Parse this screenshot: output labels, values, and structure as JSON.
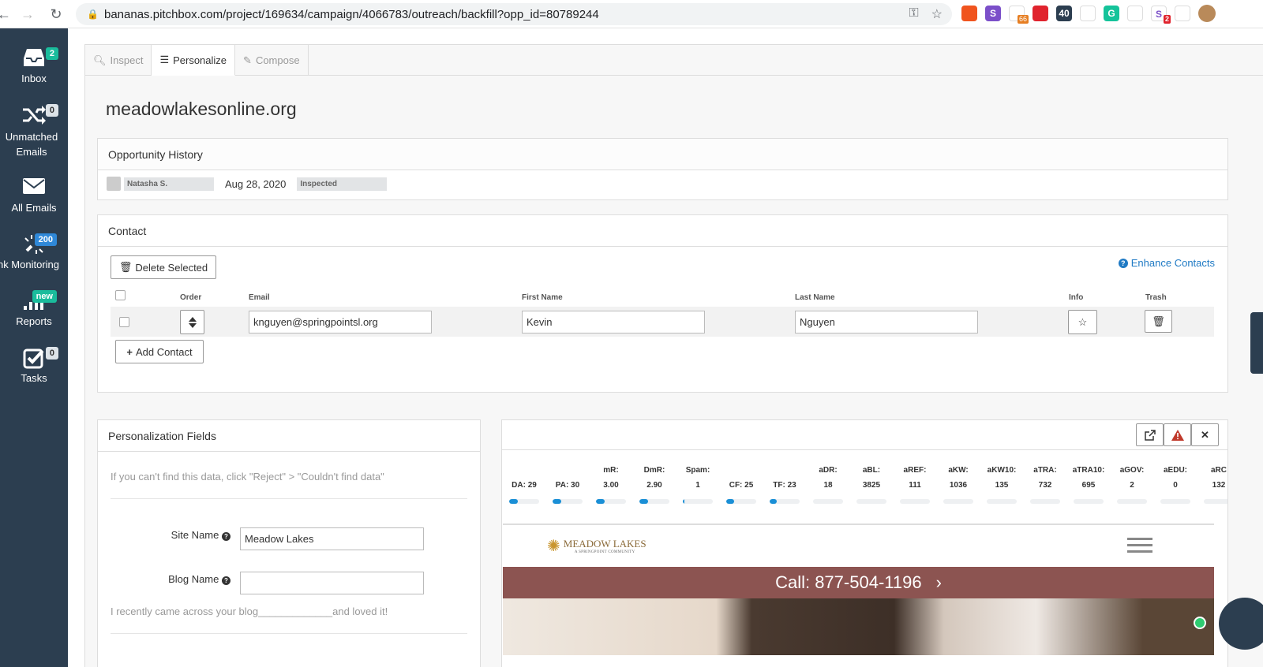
{
  "browser": {
    "url": "bananas.pitchbox.com/project/169634/campaign/4066783/outreach/backfill?opp_id=80789244",
    "extensions": [
      {
        "name": "ext-fox-icon",
        "color": "#f0541e"
      },
      {
        "name": "ext-s-icon",
        "color": "#7b4fc9",
        "glyph": "S"
      },
      {
        "name": "ext-dots-icon",
        "color": "#ffffff",
        "badge": "66",
        "badge_color": "#e67e22"
      },
      {
        "name": "ext-record-icon",
        "color": "#e0232d"
      },
      {
        "name": "ext-40-icon",
        "color": "#2c3e50",
        "glyph": "40"
      },
      {
        "name": "ext-link-icon",
        "color": "#ffffff"
      },
      {
        "name": "ext-grammarly-icon",
        "color": "#15c39a",
        "glyph": "G"
      },
      {
        "name": "ext-lastpass-icon",
        "color": "#ffffff"
      },
      {
        "name": "ext-s2-icon",
        "color": "#ffffff",
        "glyph": "S",
        "badge": "2",
        "badge_color": "#e0232d"
      },
      {
        "name": "ext-puzzle-icon",
        "color": "#ffffff"
      }
    ]
  },
  "sidebar": {
    "items": [
      {
        "label": "Inbox",
        "badge": "2"
      },
      {
        "label": "Unmatched\nEmails",
        "badge": "0"
      },
      {
        "label": "All Emails",
        "badge": ""
      },
      {
        "label": "nk Monitoring",
        "badge": "200"
      },
      {
        "label": "Reports",
        "badge": "new"
      },
      {
        "label": "Tasks",
        "badge": "0"
      }
    ]
  },
  "tabs": [
    {
      "label": "Inspect",
      "active": false
    },
    {
      "label": "Personalize",
      "active": true
    },
    {
      "label": "Compose",
      "active": false
    }
  ],
  "domain": "meadowlakesonline.org",
  "history": {
    "title": "Opportunity History",
    "user": "Natasha S.",
    "date": "Aug 28, 2020",
    "status": "Inspected"
  },
  "contact": {
    "title": "Contact",
    "delete_label": "Delete Selected",
    "enhance_label": "Enhance Contacts",
    "add_label": "Add Contact",
    "columns": {
      "order": "Order",
      "email": "Email",
      "first": "First Name",
      "last": "Last Name",
      "info": "Info",
      "trash": "Trash"
    },
    "rows": [
      {
        "email": "knguyen@springpointsl.org",
        "first": "Kevin",
        "last": "Nguyen"
      }
    ]
  },
  "personalization": {
    "title": "Personalization Fields",
    "hint": "If you can't find this data, click \"Reject\" > \"Couldn't find data\"",
    "site_name_label": "Site Name",
    "site_name_value": "Meadow Lakes",
    "blog_name_label": "Blog Name",
    "blog_name_value": "",
    "blog_sentence": "I recently came across your blog_____________and loved it!"
  },
  "metrics": [
    {
      "label": "",
      "value": "DA: 29",
      "fill": 0.29
    },
    {
      "label": "",
      "value": "PA: 30",
      "fill": 0.3
    },
    {
      "label": "mR:",
      "value": "3.00",
      "fill": 0.3
    },
    {
      "label": "DmR:",
      "value": "2.90",
      "fill": 0.29
    },
    {
      "label": "Spam:",
      "value": "1",
      "fill": 0.06
    },
    {
      "label": "",
      "value": "CF: 25",
      "fill": 0.25
    },
    {
      "label": "",
      "value": "TF: 23",
      "fill": 0.23
    },
    {
      "label": "aDR:",
      "value": "18",
      "fill": 0
    },
    {
      "label": "aBL:",
      "value": "3825",
      "fill": 0
    },
    {
      "label": "aREF:",
      "value": "111",
      "fill": 0
    },
    {
      "label": "aKW:",
      "value": "1036",
      "fill": 0
    },
    {
      "label": "aKW10:",
      "value": "135",
      "fill": 0
    },
    {
      "label": "aTRA:",
      "value": "732",
      "fill": 0
    },
    {
      "label": "aTRA10:",
      "value": "695",
      "fill": 0
    },
    {
      "label": "aGOV:",
      "value": "2",
      "fill": 0
    },
    {
      "label": "aEDU:",
      "value": "0",
      "fill": 0
    },
    {
      "label": "aRC",
      "value": "132",
      "fill": 0
    }
  ],
  "preview": {
    "logo": "MEADOW LAKES",
    "logo_sub": "A SPRINGPOINT COMMUNITY",
    "call": "Call: 877-504-1196"
  }
}
